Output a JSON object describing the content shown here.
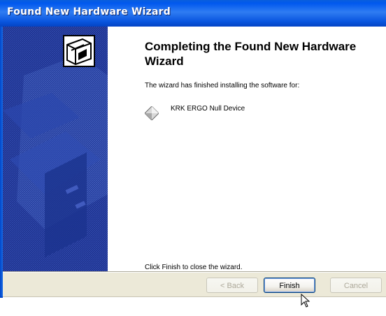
{
  "window": {
    "title": "Found New Hardware Wizard"
  },
  "main": {
    "heading": "Completing the Found New Hardware Wizard",
    "body": "The wizard has finished installing the software for:",
    "device_name": "KRK ERGO Null Device",
    "finish_hint": "Click Finish to close the wizard."
  },
  "buttons": {
    "back": "< Back",
    "finish": "Finish",
    "cancel": "Cancel"
  },
  "colors": {
    "titlebar": "#0058ee",
    "side_panel": "#1a2e8a",
    "button_bar": "#ece9d8"
  },
  "icons": {
    "wizard": "hardware-box-icon",
    "device": "device-diamond-icon",
    "cursor": "mouse-pointer-icon"
  }
}
